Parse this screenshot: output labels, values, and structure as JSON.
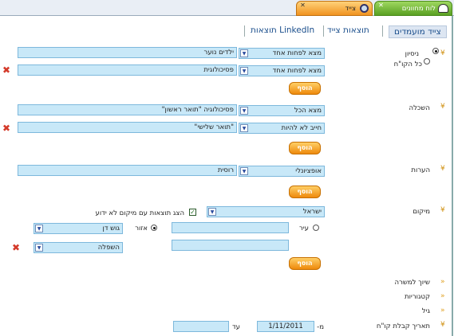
{
  "tabs": {
    "main": "לוח מחוונים",
    "scout": "צייד"
  },
  "nav": [
    "צייד מועמדים",
    "תוצאות צייד",
    "תוצאות LinkedIn"
  ],
  "experience": {
    "label": "ניסיון",
    "all_label": "כל הקו\"ח",
    "row1_select": "מצא לפחות אחד",
    "row1_value": "ילדים נוער",
    "row2_select": "מצא לפחות אחד",
    "row2_value": "פסיכולוגית",
    "add": "הוסף"
  },
  "education": {
    "label": "השכלה",
    "row1_select": "מצא הכל",
    "row1_value": "פסיכולוגיה \"תואר ראשון\"",
    "row2_select": "חייב לא להיות",
    "row2_value": "\"תואר שלישי\"",
    "add": "הוסף"
  },
  "notes": {
    "label": "הערות",
    "row1_select": "אופציונלי",
    "row1_value": "רוסית",
    "add": "הוסף"
  },
  "location": {
    "label": "מיקום",
    "country": "ישראל",
    "show_unknown": "הצג תוצאות עם מיקום לא ידוע",
    "city_label": "עיר",
    "area_label": "אזור",
    "area1": "גוש דן",
    "area2": "השפלה",
    "add": "הוסף"
  },
  "sections": [
    "שיוך למשרה",
    "קטגוריות",
    "גיל",
    "תאריך קבלת קו\"ח"
  ],
  "date": {
    "from_label": "מ-",
    "from_value": "1/11/2011",
    "to_label": "עד",
    "to_value": ""
  },
  "colors": {
    "field_bg": "#c8e8f8",
    "button": "#ee8a0c",
    "link": "#1a4e8c"
  }
}
